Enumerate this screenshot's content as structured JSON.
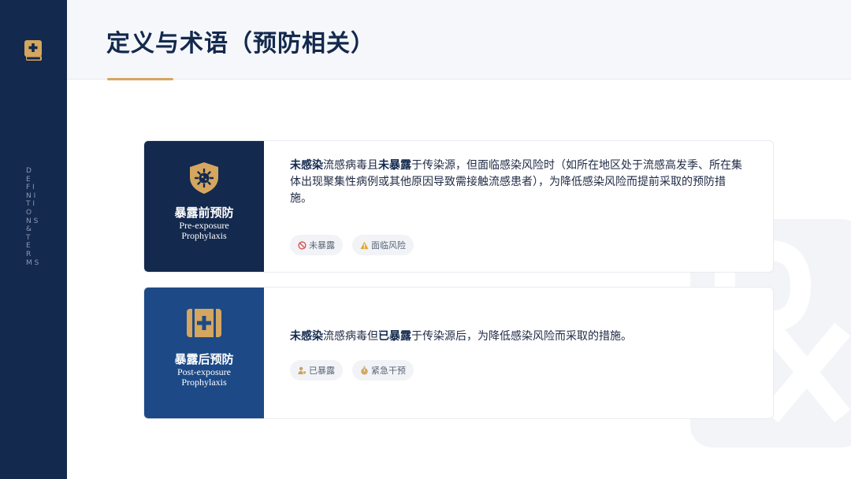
{
  "sidebar": {
    "logo_icon": "medical-book-icon",
    "vertical_text": [
      "D",
      "E",
      "F I",
      "N I",
      "T I",
      "O",
      "N S",
      "&",
      "T",
      "E",
      "R",
      "M S"
    ]
  },
  "header": {
    "title": "定义与术语（预防相关）"
  },
  "cards": [
    {
      "icon": "shield-virus-icon",
      "name": "暴露前预防",
      "en_line1": "Pre-exposure",
      "en_line2": "Prophylaxis",
      "text_parts": [
        "未感染",
        "流感病毒且",
        "未暴露",
        "于传染源，但面临感染风险时（如所在地区处于流感高发季、所在集体出现聚集性病例或其他原因导致需接触流感患者），为降低感染风险而提前采取的预防措施。"
      ],
      "tags": [
        {
          "icon": "ban-icon",
          "label": "未暴露"
        },
        {
          "icon": "warning-icon",
          "label": "面临风险"
        }
      ],
      "colors": {
        "panel": "#13294d",
        "accent": "#d4a660"
      }
    },
    {
      "icon": "first-aid-kit-icon",
      "name": "暴露后预防",
      "en_line1": "Post-exposure",
      "en_line2": "Prophylaxis",
      "text_parts": [
        "未感染",
        "流感病毒但",
        "已暴露",
        "于传染源后，为降低感染风险而采取的措施。"
      ],
      "tags": [
        {
          "icon": "person-virus-icon",
          "label": "已暴露"
        },
        {
          "icon": "stopwatch-icon",
          "label": "紧急干预"
        }
      ],
      "colors": {
        "panel": "#1d4a86",
        "accent": "#d4a660"
      }
    }
  ],
  "watermark_icon": "prescription-rx-icon"
}
